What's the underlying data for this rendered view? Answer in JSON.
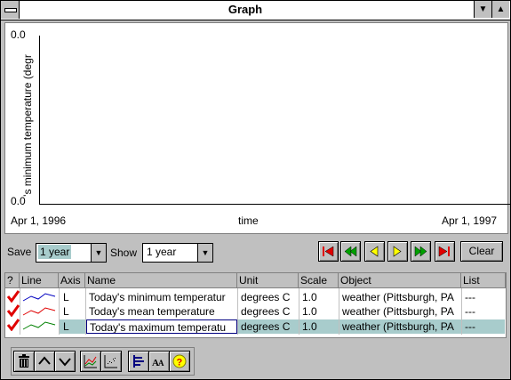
{
  "window": {
    "title": "Graph"
  },
  "graph": {
    "y_axis_label": "'s minimum temperature (degr",
    "y_top": "0.0",
    "y_bottom": "0.0",
    "x_start": "Apr 1, 1996",
    "x_mid": "time",
    "x_end": "Apr 1, 1997"
  },
  "controls": {
    "save_label": "Save",
    "save_value": "1 year",
    "show_label": "Show",
    "show_value": "1 year",
    "clear_label": "Clear"
  },
  "table": {
    "headers": [
      "?",
      "Line",
      "Axis",
      "Name",
      "Unit",
      "Scale",
      "Object",
      "List"
    ],
    "rows": [
      {
        "axis": "L",
        "name": "Today's minimum temperatur",
        "unit": "degrees C",
        "scale": "1.0",
        "object": "weather (Pittsburgh, PA",
        "list": "---",
        "line_color": "#0000c0"
      },
      {
        "axis": "L",
        "name": "Today's mean temperature",
        "unit": "degrees C",
        "scale": "1.0",
        "object": "weather (Pittsburgh, PA",
        "list": "---",
        "line_color": "#e00000"
      },
      {
        "axis": "L",
        "name": "Today's maximum temperatu",
        "unit": "degrees C",
        "scale": "1.0",
        "object": "weather (Pittsburgh, PA",
        "list": "---",
        "line_color": "#008000"
      }
    ]
  },
  "colors": {
    "check": "#e00000",
    "nav_arrow": "#ffff00",
    "nav_green": "#00a000",
    "nav_red": "#e00000",
    "selected_row": "#a8cccc"
  }
}
